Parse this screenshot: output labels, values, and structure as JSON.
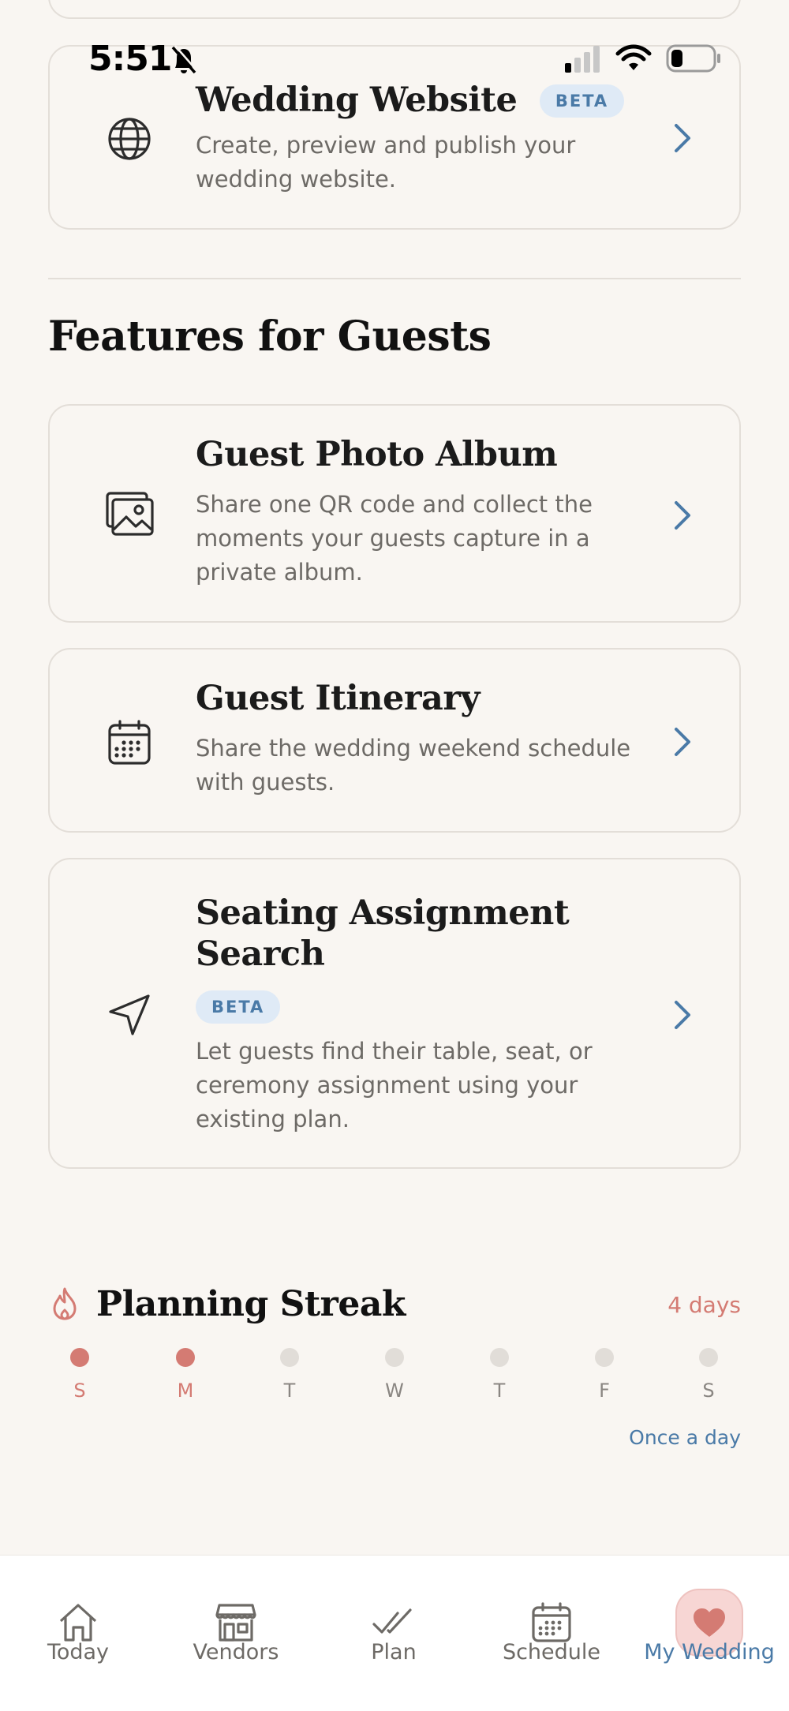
{
  "status_bar": {
    "time": "5:51"
  },
  "cards_top": [
    {
      "title": "Wedding Website",
      "badge": "BETA",
      "description": "Create, preview and publish your wedding website."
    }
  ],
  "section": {
    "title": "Features for Guests"
  },
  "cards": [
    {
      "title": "Guest Photo Album",
      "description": "Share one QR code and collect the moments your guests capture in a private album."
    },
    {
      "title": "Guest Itinerary",
      "description": "Share the wedding weekend schedule with guests."
    },
    {
      "title": "Seating Assignment Search",
      "badge": "BETA",
      "description": "Let guests find their table, seat, or ceremony assignment using your existing plan."
    }
  ],
  "streak": {
    "title": "Planning Streak",
    "days_label": "4 days",
    "days": [
      {
        "label": "S",
        "active": true
      },
      {
        "label": "M",
        "active": true
      },
      {
        "label": "T",
        "active": false
      },
      {
        "label": "W",
        "active": false
      },
      {
        "label": "T",
        "active": false
      },
      {
        "label": "F",
        "active": false
      },
      {
        "label": "S",
        "active": false
      }
    ],
    "frequency": "Once a day"
  },
  "tabbar": {
    "tabs": [
      {
        "label": "Today",
        "icon": "home-icon"
      },
      {
        "label": "Vendors",
        "icon": "storefront-icon"
      },
      {
        "label": "Plan",
        "icon": "double-check-icon"
      },
      {
        "label": "Schedule",
        "icon": "calendar-icon"
      },
      {
        "label": "My Wedding",
        "icon": "heart-icon",
        "active": true
      }
    ]
  },
  "colors": {
    "accent_blue": "#4a7aa7",
    "accent_rose": "#d47b73",
    "background": "#f9f6f2",
    "badge_bg": "#dfeaf6"
  }
}
